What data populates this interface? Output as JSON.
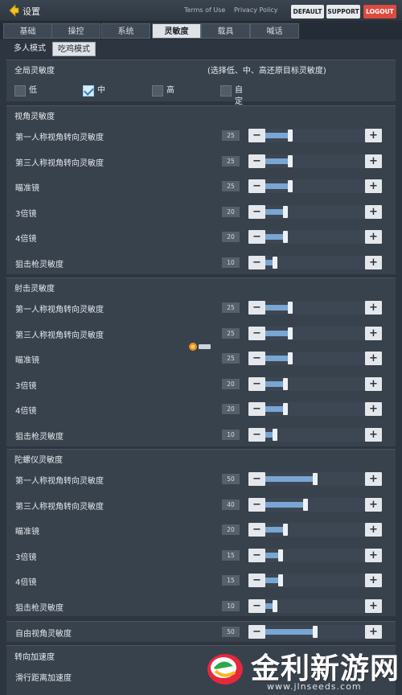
{
  "header": {
    "title": "设置",
    "terms": "Terms of Use",
    "privacy": "Privacy Policy",
    "default_btn": "DEFAULT",
    "support_btn": "SUPPORT",
    "logout_btn": "LOGOUT"
  },
  "tabs": [
    "基础",
    "操控",
    "系统",
    "灵敏度",
    "载具",
    "喊话"
  ],
  "subtabs": [
    "多人模式",
    "吃鸡模式"
  ],
  "global": {
    "title": "全局灵敏度",
    "hint": "(选择低、中、高还原目标灵敏度)",
    "options": [
      {
        "label": "低",
        "checked": false
      },
      {
        "label": "中",
        "checked": true
      },
      {
        "label": "高",
        "checked": false
      },
      {
        "label": "自定义",
        "checked": false
      }
    ]
  },
  "sections": [
    {
      "title": "视角灵敏度",
      "rows": [
        {
          "label": "第一人称视角转向灵敏度",
          "value": "25"
        },
        {
          "label": "第三人称视角转向灵敏度",
          "value": "25"
        },
        {
          "label": "瞄准镜",
          "value": "25"
        },
        {
          "label": "3倍镜",
          "value": "20"
        },
        {
          "label": "4倍镜",
          "value": "20"
        },
        {
          "label": "狙击枪灵敏度",
          "value": "10"
        }
      ]
    },
    {
      "title": "射击灵敏度",
      "rows": [
        {
          "label": "第一人称视角转向灵敏度",
          "value": "25"
        },
        {
          "label": "第三人称视角转向灵敏度",
          "value": "25"
        },
        {
          "label": "瞄准镜",
          "value": "25"
        },
        {
          "label": "3倍镜",
          "value": "20"
        },
        {
          "label": "4倍镜",
          "value": "20"
        },
        {
          "label": "狙击枪灵敏度",
          "value": "10"
        }
      ]
    },
    {
      "title": "陀螺仪灵敏度",
      "rows": [
        {
          "label": "第一人称视角转向灵敏度",
          "value": "50"
        },
        {
          "label": "第三人称视角转向灵敏度",
          "value": "40"
        },
        {
          "label": "瞄准镜",
          "value": "20"
        },
        {
          "label": "3倍镜",
          "value": "15"
        },
        {
          "label": "4倍镜",
          "value": "15"
        },
        {
          "label": "狙击枪灵敏度",
          "value": "10"
        }
      ]
    }
  ],
  "free_look": {
    "label": "自由视角灵敏度",
    "value": "50"
  },
  "turn_accel": {
    "title": "转向加速度",
    "sub": "滑行距离加速度"
  },
  "slider_max": 100,
  "watermark": {
    "text": "金利新游网",
    "url": "www.jlnseeds.com"
  },
  "icons": {
    "back": "back-arrow-icon",
    "check": "check-icon",
    "minus": "minus-icon",
    "plus": "plus-icon"
  },
  "colors": {
    "accent_fill": "#79a6d3",
    "logout": "#dd4a3e",
    "back_arrow": "#f2c31a"
  }
}
